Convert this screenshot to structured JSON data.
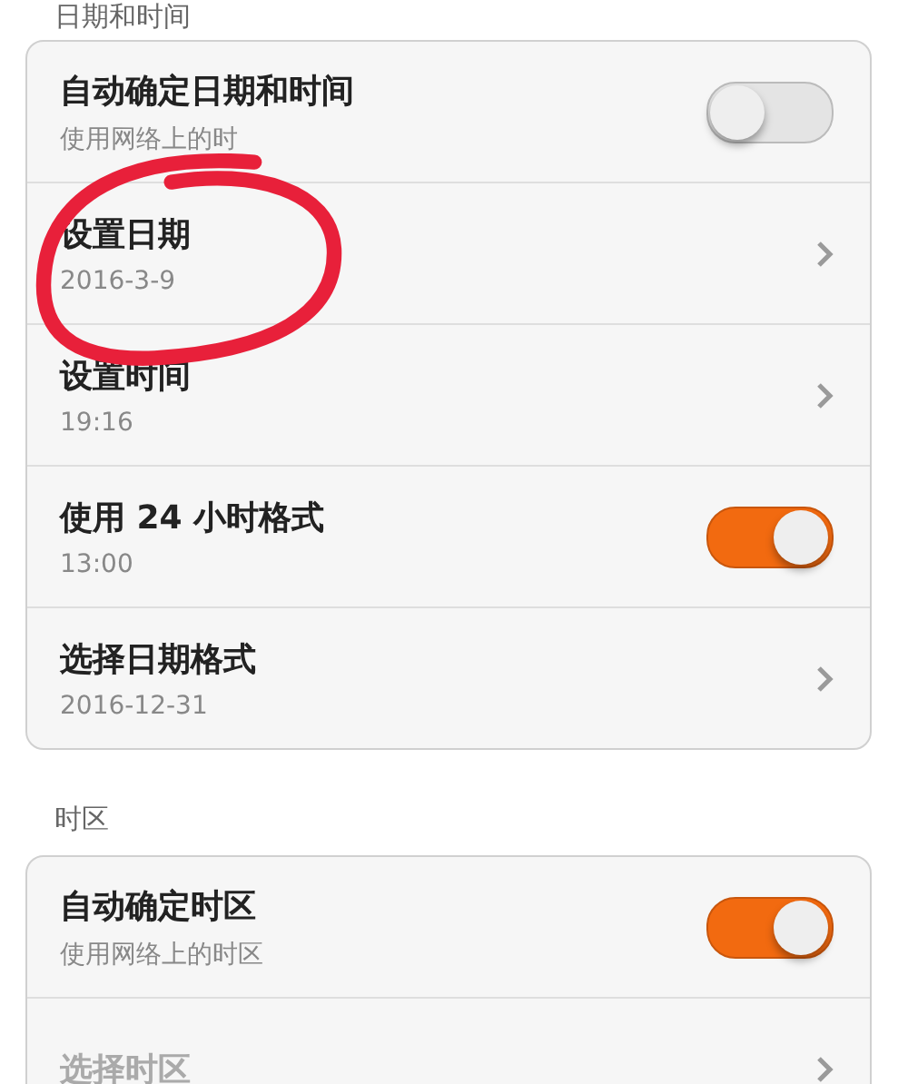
{
  "sections": [
    {
      "title": "日期和时间",
      "rows": [
        {
          "kind": "toggle",
          "title": "自动确定日期和时间",
          "subtitle": "使用网络上的时",
          "on": false,
          "disabled": false
        },
        {
          "kind": "link",
          "title": "设置日期",
          "subtitle": "2016-3-9",
          "disabled": false
        },
        {
          "kind": "link",
          "title": "设置时间",
          "subtitle": "19:16",
          "disabled": false
        },
        {
          "kind": "toggle",
          "title": "使用 24 小时格式",
          "subtitle": "13:00",
          "on": true,
          "disabled": false
        },
        {
          "kind": "link",
          "title": "选择日期格式",
          "subtitle": "2016-12-31",
          "disabled": false
        }
      ]
    },
    {
      "title": "时区",
      "rows": [
        {
          "kind": "toggle",
          "title": "自动确定时区",
          "subtitle": "使用网络上的时区",
          "on": true,
          "disabled": false
        },
        {
          "kind": "link",
          "title": "选择时区",
          "disabled": true
        }
      ]
    }
  ]
}
